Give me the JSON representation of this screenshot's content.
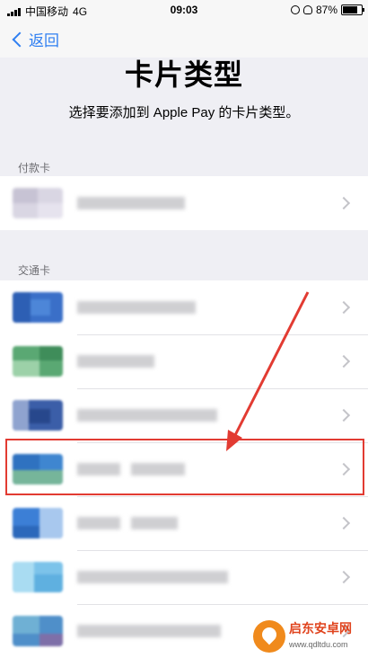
{
  "status_bar": {
    "carrier": "中国移动",
    "network": "4G",
    "time": "09:03",
    "battery_percent": "87%",
    "battery_level": 0.87
  },
  "nav": {
    "back_label": "返回"
  },
  "header": {
    "title": "卡片类型",
    "subtitle": "选择要添加到 Apple Pay 的卡片类型。"
  },
  "sections": {
    "payment": {
      "label": "付款卡"
    },
    "transit": {
      "label": "交通卡"
    }
  },
  "colors": {
    "accent": "#2f7ff1",
    "highlight": "#e23b32",
    "background": "#efeff4"
  },
  "icons": {
    "back": "chevron-left-icon",
    "disclosure": "chevron-right-icon",
    "annotation": "red-arrow"
  },
  "watermark": {
    "name": "启东安卓网",
    "url": "www.qdltdu.com"
  }
}
